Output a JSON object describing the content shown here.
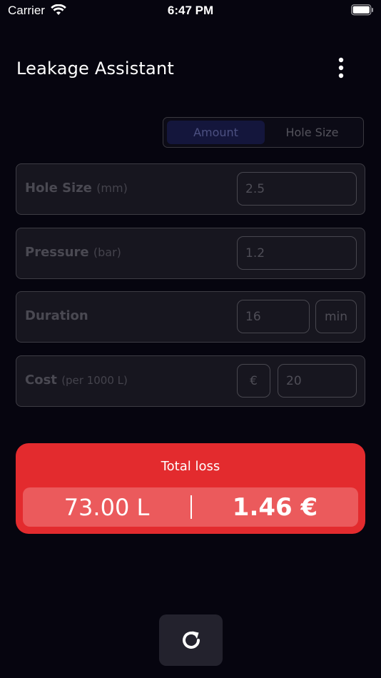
{
  "status_bar": {
    "carrier": "Carrier",
    "time": "6:47 PM"
  },
  "header": {
    "title": "Leakage Assistant",
    "menu_icon": "more-vertical-icon"
  },
  "mode_toggle": {
    "options": [
      "Amount",
      "Hole Size"
    ],
    "selected": "Amount"
  },
  "fields": {
    "hole_size": {
      "label": "Hole Size",
      "unit": "(mm)",
      "value": "2.5"
    },
    "pressure": {
      "label": "Pressure",
      "unit": "(bar)",
      "value": "1.2"
    },
    "duration": {
      "label": "Duration",
      "value": "16",
      "unit": "min"
    },
    "cost": {
      "label": "Cost",
      "unit": "(per 1000 L)",
      "currency": "€",
      "value": "20"
    }
  },
  "result": {
    "title": "Total loss",
    "liters": "73.00 L",
    "cost": "1.46 €"
  },
  "actions": {
    "reset_icon": "refresh-icon"
  },
  "colors": {
    "background": "#06050f",
    "accent_red": "#e32b2e",
    "segment_active": "#14163c"
  }
}
